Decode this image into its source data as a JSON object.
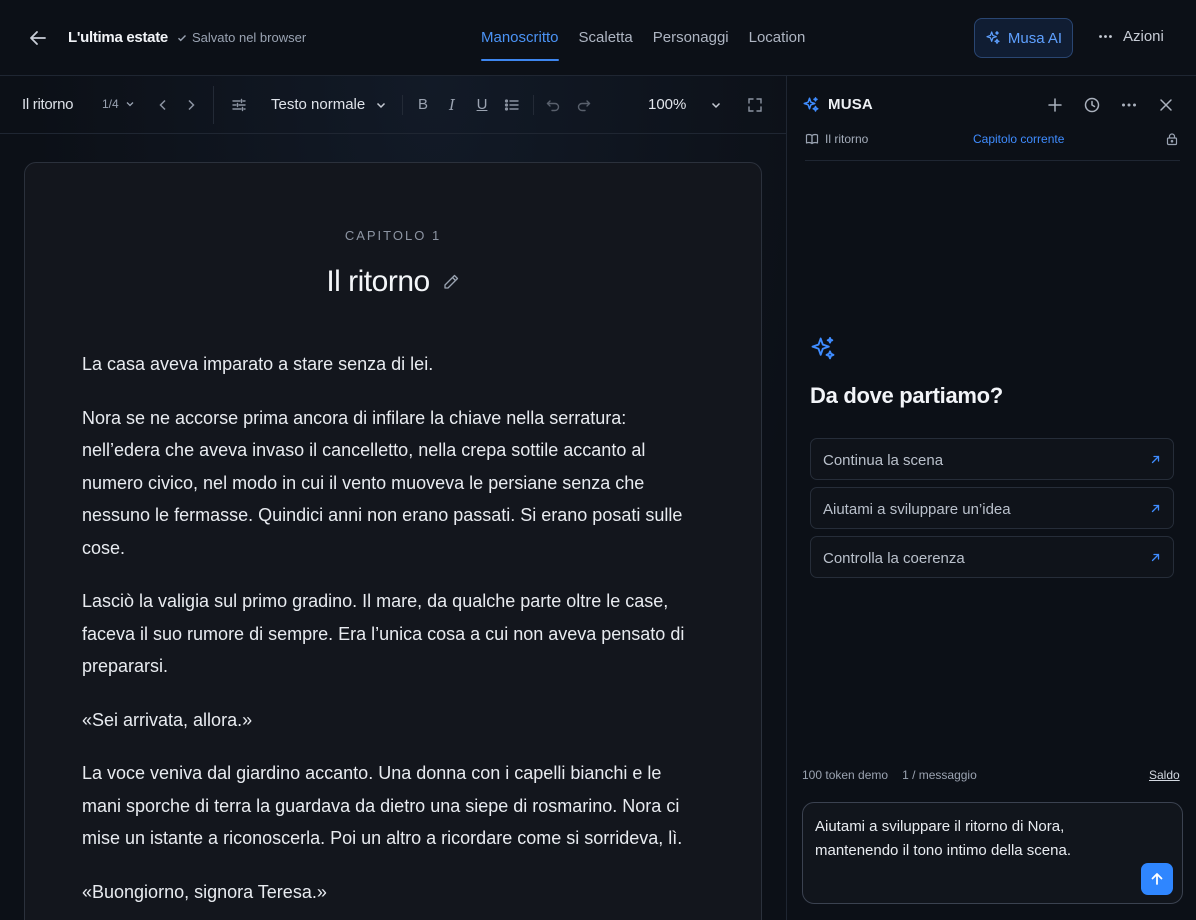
{
  "header": {
    "title": "L'ultima estate",
    "saved_status": "Salvato nel browser",
    "tabs": [
      {
        "label": "Manoscritto",
        "active": true
      },
      {
        "label": "Scaletta",
        "active": false
      },
      {
        "label": "Personaggi",
        "active": false
      },
      {
        "label": "Location",
        "active": false
      }
    ],
    "musa_button": "Musa AI",
    "actions_label": "Azioni"
  },
  "toolbar": {
    "chapter_name": "Il ritorno",
    "page_indicator": "1/4",
    "text_style": "Testo normale",
    "bold": "B",
    "italic": "I",
    "underline": "U",
    "zoom": "100%"
  },
  "editor": {
    "chapter_label": "CAPITOLO 1",
    "chapter_title": "Il ritorno",
    "paragraphs": [
      "La casa aveva imparato a stare senza di lei.",
      "Nora se ne accorse prima ancora di infilare la chiave nella serratura: nell’edera che aveva invaso il cancelletto, nella crepa sottile accanto al numero civico, nel modo in cui il vento muoveva le persiane senza che nessuno le fermasse. Quindici anni non erano passati. Si erano posati sulle cose.",
      "Lasciò la valigia sul primo gradino. Il mare, da qualche parte oltre le case, faceva il suo rumore di sempre. Era l’unica cosa a cui non aveva pensato di prepararsi.",
      "«Sei arrivata, allora.»",
      "La voce veniva dal giardino accanto. Una donna con i capelli bianchi e le mani sporche di terra la guardava da dietro una siepe di rosmarino. Nora ci mise un istante a riconoscerla. Poi un altro a ricordare come si sorrideva, lì.",
      "«Buongiorno, signora Teresa.»"
    ]
  },
  "panel": {
    "title": "MUSA",
    "context_chapter": "Il ritorno",
    "context_scope": "Capitolo corrente",
    "empty_title": "Da dove partiamo?",
    "suggestions": [
      "Continua la scena",
      "Aiutami a sviluppare un’idea",
      "Controlla la coerenza"
    ],
    "token_info": "100 token demo",
    "cost_info": "1 / messaggio",
    "balance_link": "Saldo",
    "composer_text": "Aiutami a sviluppare il ritorno di Nora, mantenendo il tono intimo della scena."
  },
  "colors": {
    "accent": "#3f8cff",
    "background": "#0d1118",
    "page": "#13161d"
  }
}
